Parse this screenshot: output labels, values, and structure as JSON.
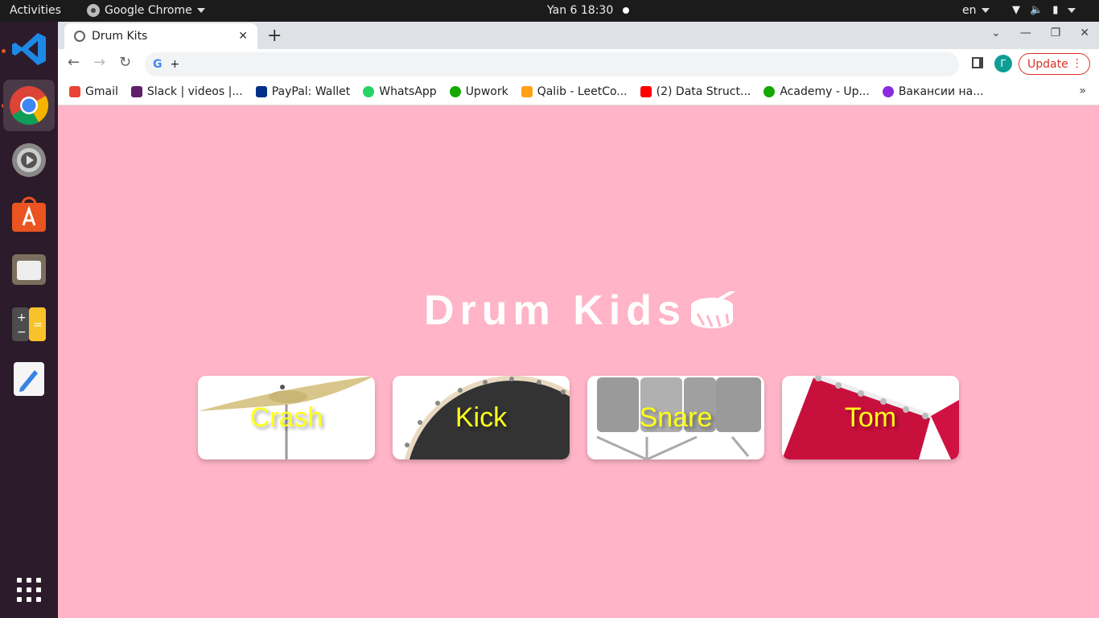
{
  "topbar": {
    "activities": "Activities",
    "app_name": "Google Chrome",
    "datetime": "Yan 6  18:30",
    "lang": "en"
  },
  "dock": {
    "items": [
      "vscode-icon",
      "chrome-icon",
      "settings-icon",
      "software-center-icon",
      "files-icon",
      "calculator-icon",
      "text-editor-icon",
      "app-grid-icon"
    ]
  },
  "browser": {
    "tab_title": "Drum Kits",
    "omnibox_text": "+",
    "profile_initial": "Г",
    "update_label": "Update",
    "bookmarks": [
      {
        "label": "Gmail",
        "color": "#ea4335"
      },
      {
        "label": "Slack | videos |...",
        "color": "#611f69"
      },
      {
        "label": "PayPal: Wallet",
        "color": "#003087"
      },
      {
        "label": "WhatsApp",
        "color": "#25d366"
      },
      {
        "label": "Upwork",
        "color": "#14a800"
      },
      {
        "label": "Qalib - LeetCo...",
        "color": "#ffa116"
      },
      {
        "label": "(2) Data Struct...",
        "color": "#ff0000"
      },
      {
        "label": "Academy - Up...",
        "color": "#14a800"
      },
      {
        "label": "Вакансии на...",
        "color": "#8a2be2"
      }
    ]
  },
  "page": {
    "title": "Drum Kids",
    "background": "#ffb4c8",
    "label_color": "#ffff1a",
    "pads": [
      {
        "label": "Crash",
        "image": "cymbal"
      },
      {
        "label": "Kick",
        "image": "kick-drum"
      },
      {
        "label": "Snare",
        "image": "snare-drums"
      },
      {
        "label": "Tom",
        "image": "tom-drum"
      }
    ]
  }
}
